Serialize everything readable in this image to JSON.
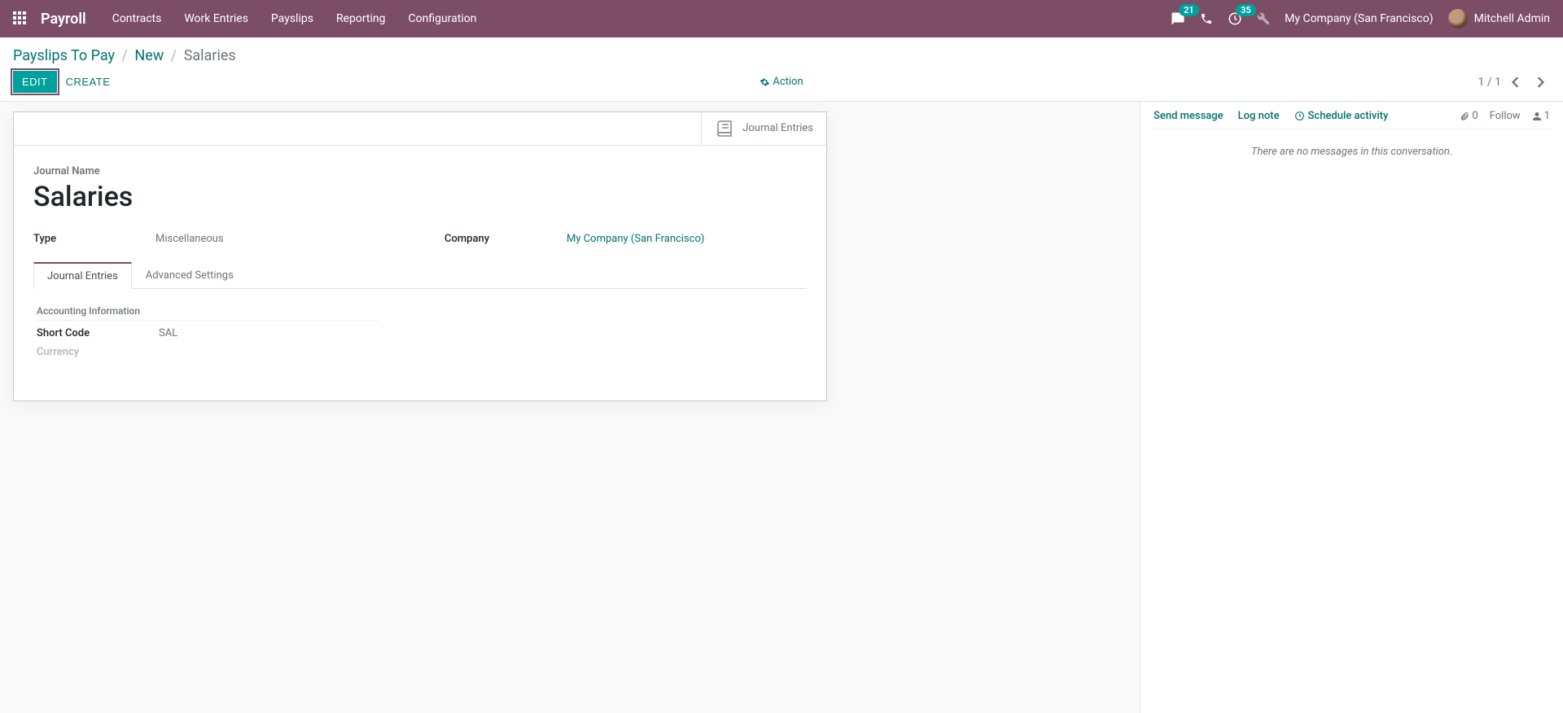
{
  "topbar": {
    "brand": "Payroll",
    "menu": [
      "Contracts",
      "Work Entries",
      "Payslips",
      "Reporting",
      "Configuration"
    ],
    "messages_count": "21",
    "activities_count": "35",
    "company": "My Company (San Francisco)",
    "user": "Mitchell Admin"
  },
  "breadcrumb": {
    "a": "Payslips To Pay",
    "b": "New",
    "c": "Salaries"
  },
  "buttons": {
    "edit": "Edit",
    "create": "Create",
    "action": "Action"
  },
  "pager": {
    "text": "1 / 1"
  },
  "stat": {
    "journal_entries": "Journal Entries"
  },
  "form": {
    "journal_name_label": "Journal Name",
    "journal_name": "Salaries",
    "type_label": "Type",
    "type_value": "Miscellaneous",
    "company_label": "Company",
    "company_value": "My Company (San Francisco)"
  },
  "tabs": {
    "journal_entries": "Journal Entries",
    "advanced": "Advanced Settings"
  },
  "tab_content": {
    "section": "Accounting Information",
    "short_code_label": "Short Code",
    "short_code_value": "SAL",
    "currency_label": "Currency",
    "currency_value": ""
  },
  "chatter": {
    "send": "Send message",
    "log": "Log note",
    "schedule": "Schedule activity",
    "attachments": "0",
    "follow": "Follow",
    "followers": "1",
    "empty": "There are no messages in this conversation."
  }
}
